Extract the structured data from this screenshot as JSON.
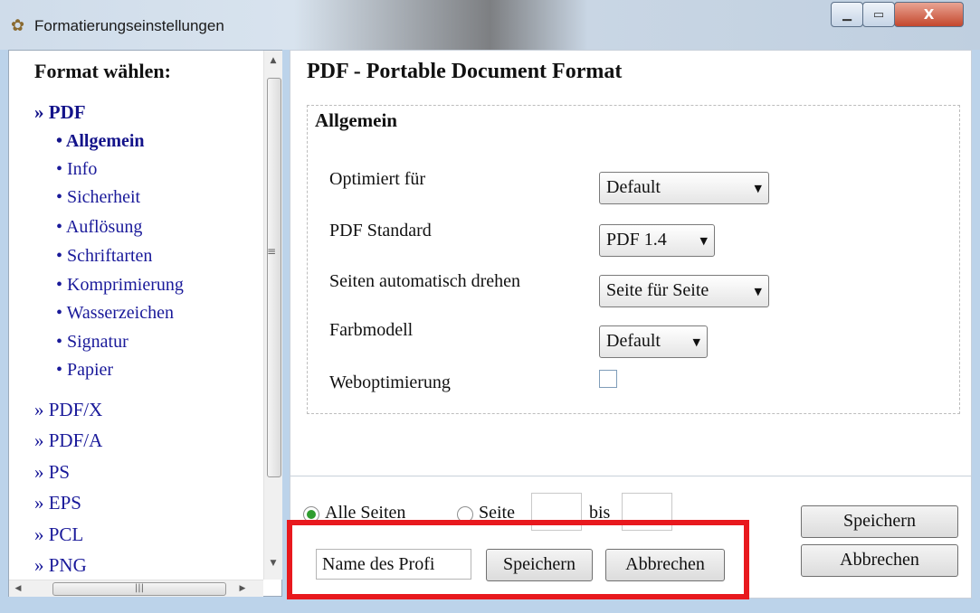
{
  "window": {
    "title": "Formatierungseinstellungen",
    "icon": "app-icon",
    "controls": {
      "minimize": "minimize-icon",
      "maximize": "maximize-icon",
      "close": "close-icon"
    }
  },
  "sidebar": {
    "heading": "Format wählen:",
    "formats": [
      {
        "label": "» PDF",
        "active": true,
        "children": [
          "• Allgemein",
          "• Info",
          "• Sicherheit",
          "• Auflösung",
          "• Schriftarten",
          "• Komprimierung",
          "• Wasserzeichen",
          "• Signatur",
          "• Papier"
        ],
        "active_child": "• Allgemein"
      },
      {
        "label": "» PDF/X"
      },
      {
        "label": "» PDF/A"
      },
      {
        "label": "» PS"
      },
      {
        "label": "» EPS"
      },
      {
        "label": "» PCL"
      },
      {
        "label": "» PNG"
      }
    ]
  },
  "main": {
    "title": "PDF - Portable Document Format",
    "group": {
      "title": "Allgemein",
      "fields": [
        {
          "label": "Optimiert für",
          "type": "select",
          "value": "Default"
        },
        {
          "label": "PDF Standard",
          "type": "select",
          "value": "PDF 1.4"
        },
        {
          "label": "Seiten automatisch drehen",
          "type": "select",
          "value": "Seite für Seite"
        },
        {
          "label": "Farbmodell",
          "type": "select",
          "value": "Default"
        },
        {
          "label": "Weboptimierung",
          "type": "checkbox",
          "checked": false
        }
      ]
    }
  },
  "footer": {
    "radio_all": "Alle Seiten",
    "radio_page": "Seite",
    "to_label": "bis",
    "profile_input_value": "Name des Profi",
    "save_label": "Speichern",
    "cancel_label": "Abbrechen"
  },
  "accent": {
    "highlight": "#e8191e",
    "radio_selected": "#2f9d2f",
    "link": "#1a1a9a"
  }
}
